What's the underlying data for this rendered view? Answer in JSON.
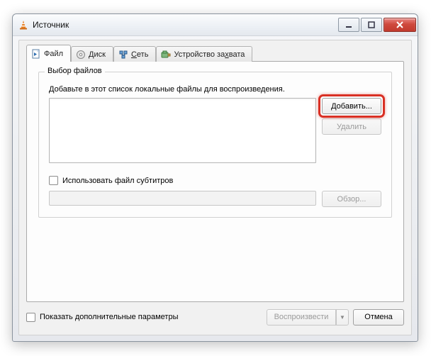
{
  "window": {
    "title": "Источник"
  },
  "tabs": {
    "file": "Файл",
    "disc": "Диск",
    "net_prefix": "С",
    "net_rest": "еть",
    "capture_prefix": "Устройство за",
    "capture_rest": "вата",
    "capture_underline": "х"
  },
  "group_file": {
    "legend": "Выбор файлов",
    "hint": "Добавьте в этот список локальные файлы для воспроизведения.",
    "add_btn": "Добавить...",
    "remove_btn": "Удалить"
  },
  "subtitles": {
    "checkbox_label": "Использовать файл субтитров",
    "browse_btn": "Обзор..."
  },
  "footer": {
    "extra_checkbox": "Показать дополнительные параметры",
    "play_btn": "Воспроизвести",
    "cancel_btn": "Отмена"
  }
}
